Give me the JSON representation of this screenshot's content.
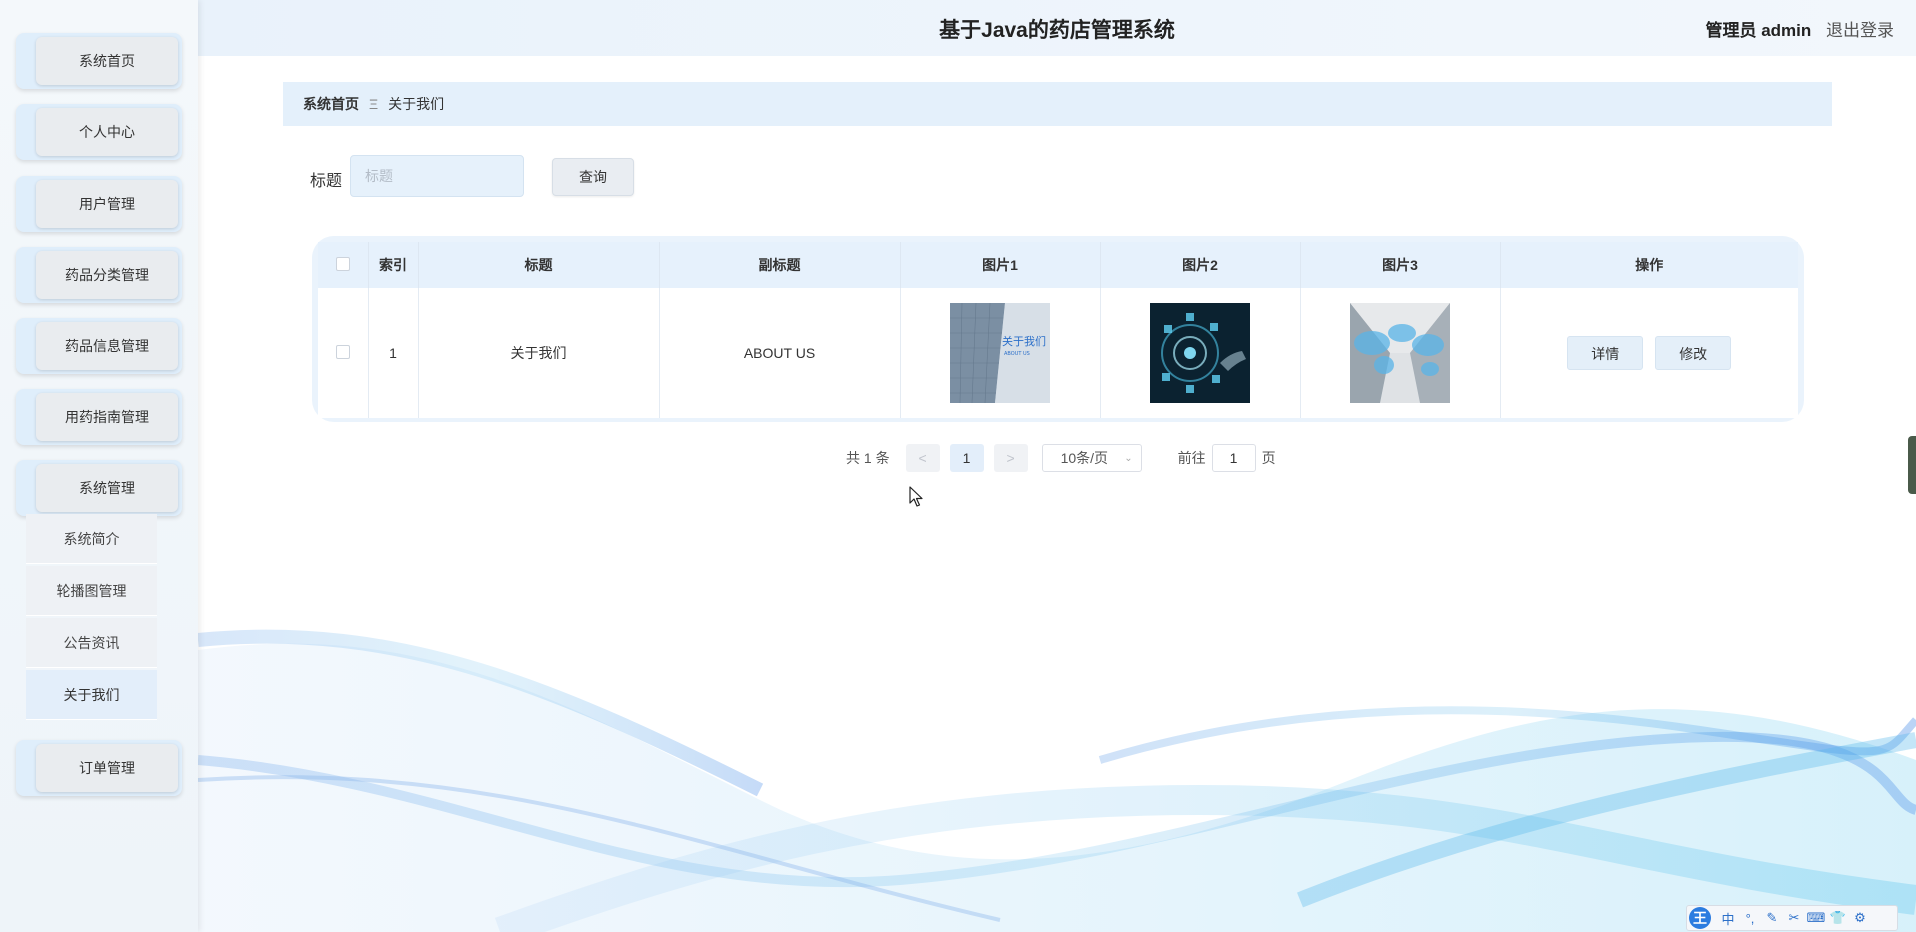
{
  "header": {
    "title": "基于Java的药店管理系统",
    "admin": "管理员 admin",
    "logout": "退出登录"
  },
  "sidebar": {
    "items": [
      {
        "label": "系统首页"
      },
      {
        "label": "个人中心"
      },
      {
        "label": "用户管理"
      },
      {
        "label": "药品分类管理"
      },
      {
        "label": "药品信息管理"
      },
      {
        "label": "用药指南管理"
      },
      {
        "label": "系统管理"
      },
      {
        "label": "订单管理"
      }
    ],
    "submenu": [
      {
        "label": "系统简介"
      },
      {
        "label": "轮播图管理"
      },
      {
        "label": "公告资讯"
      },
      {
        "label": "关于我们"
      }
    ]
  },
  "breadcrumb": {
    "home": "系统首页",
    "separator": "Ξ",
    "current": "关于我们"
  },
  "search": {
    "label": "标题",
    "placeholder": "标题",
    "button": "查询"
  },
  "table": {
    "headers": [
      "索引",
      "标题",
      "副标题",
      "图片1",
      "图片2",
      "图片3",
      "操作"
    ],
    "rows": [
      {
        "index": "1",
        "title": "关于我们",
        "subtitle": "ABOUT US",
        "image1_text": "关于我们",
        "image1_subtext": "ABOUT US",
        "actions": [
          "详情",
          "修改"
        ]
      }
    ]
  },
  "pagination": {
    "total": "共 1 条",
    "prev": "<",
    "page": "1",
    "next": ">",
    "page_size": "10条/页",
    "goto_label": "前往",
    "goto_value": "1",
    "page_unit": "页"
  },
  "ime": {
    "logo": "王",
    "mode": "中"
  }
}
